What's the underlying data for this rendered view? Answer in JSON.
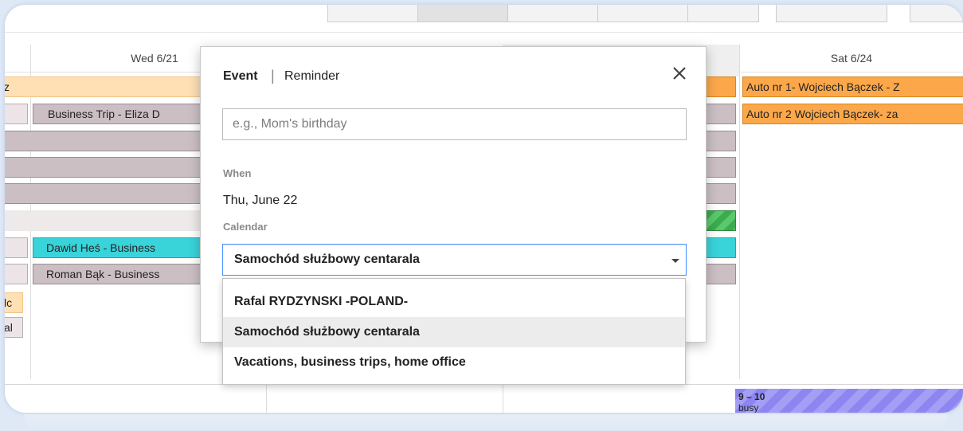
{
  "calendar": {
    "days": [
      {
        "label": "Wed 6/21"
      },
      {
        "label": "Sat 6/24"
      }
    ],
    "events": {
      "wed_business_trip": "Business Trip - Eliza D",
      "wed_dawid": "Dawid Heś - Business",
      "wed_roman": "Roman Bąk - Business",
      "left_frag_1": "z",
      "left_frag_2": "lc",
      "left_frag_3": "al",
      "sat_auto_1": "Auto nr 1- Wojciech Bączek - Z",
      "sat_auto_2": "Auto nr 2 Wojciech Bączek- za",
      "busy_time": "9 – 10",
      "busy_label": "busy"
    }
  },
  "dialog": {
    "tab_event": "Event",
    "tab_separator": "|",
    "tab_reminder": "Reminder",
    "title_placeholder": "e.g., Mom's birthday",
    "when_label": "When",
    "when_value": "Thu, June 22",
    "calendar_label": "Calendar",
    "calendar_selected": "Samochód służbowy centarala",
    "close_icon": "close-icon"
  },
  "dropdown": {
    "options": [
      "Rafal RYDZYNSKI -POLAND-",
      "Samochód służbowy centarala",
      "Vacations, business trips, home office"
    ],
    "selected_index": 1
  },
  "colors": {
    "accent_blue": "#4d90fe",
    "orange_event": "#fca84a",
    "grey_event": "#cbbfc4",
    "cyan_event": "#39d3da",
    "busy_purple": "#8d86f0"
  }
}
